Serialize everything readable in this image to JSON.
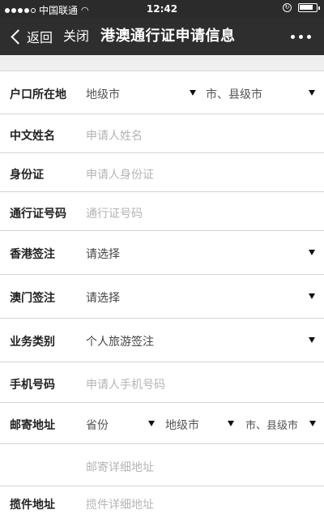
{
  "status_bar": {
    "carrier": "中国联通",
    "time": "12:42",
    "battery_level": 0.85
  },
  "nav": {
    "back_label": "返回",
    "close_label": "关闭",
    "title": "港澳通行证申请信息"
  },
  "form": {
    "hukou": {
      "label": "户口所在地",
      "city_placeholder": "地级市",
      "county_placeholder": "市、县级市"
    },
    "name": {
      "label": "中文姓名",
      "placeholder": "申请人姓名"
    },
    "id_card": {
      "label": "身份证",
      "placeholder": "申请人身份证"
    },
    "permit_no": {
      "label": "通行证号码",
      "placeholder": "通行证号码"
    },
    "hk_visa": {
      "label": "香港签注",
      "value": "请选择"
    },
    "macau_visa": {
      "label": "澳门签注",
      "value": "请选择"
    },
    "business_type": {
      "label": "业务类别",
      "value": "个人旅游签注"
    },
    "phone": {
      "label": "手机号码",
      "placeholder": "申请人手机号码"
    },
    "mail_address": {
      "label": "邮寄地址",
      "province_placeholder": "省份",
      "city_placeholder": "地级市",
      "county_placeholder": "市、县级市",
      "detail_placeholder": "邮寄详细地址"
    },
    "pickup_address": {
      "label": "揽件地址",
      "placeholder": "揽件详细地址"
    }
  }
}
